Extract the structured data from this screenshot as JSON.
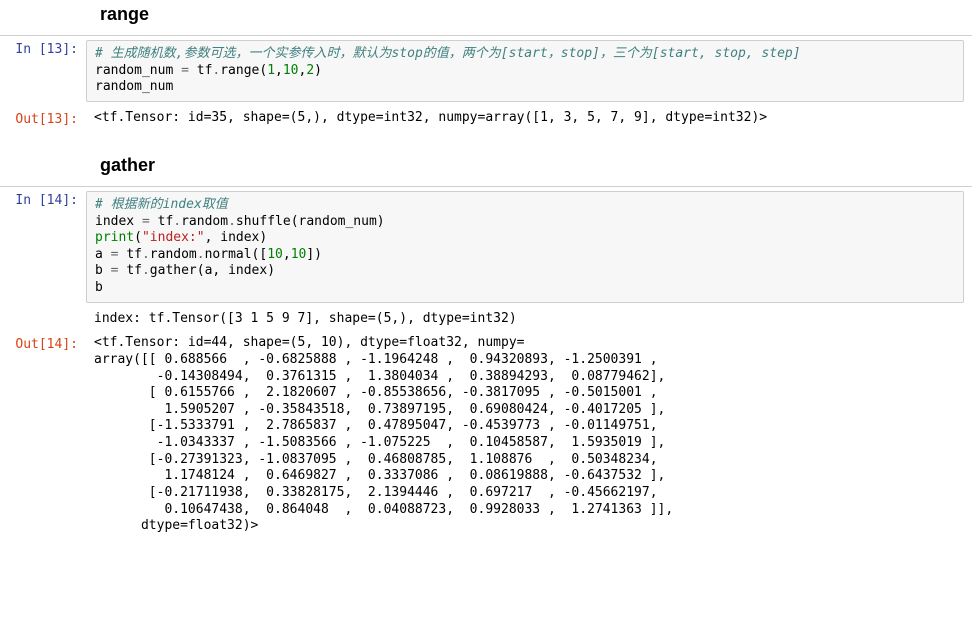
{
  "heading1": "range",
  "heading2": "gather",
  "cell13": {
    "in_label": "In [13]:",
    "out_label": "Out[13]:",
    "comment": "# 生成随机数,参数可选，一个实参传入时，默认为stop的值，两个为[start，stop]，三个为[start, stop, step]",
    "line2_a": "random_num ",
    "line2_eq": "= ",
    "line2_b": "tf",
    "line2_dot1": ".",
    "line2_c": "range(",
    "line2_n1": "1",
    "line2_com1": ",",
    "line2_n2": "10",
    "line2_com2": ",",
    "line2_n3": "2",
    "line2_d": ")",
    "line3": "random_num",
    "out": "<tf.Tensor: id=35, shape=(5,), dtype=int32, numpy=array([1, 3, 5, 7, 9], dtype=int32)>"
  },
  "cell14": {
    "in_label": "In [14]:",
    "out_label": "Out[14]:",
    "comment": "# 根据新的index取值",
    "l2a": "index ",
    "l2eq": "= ",
    "l2b": "tf",
    "l2dot": ".",
    "l2c": "random",
    "l2dot2": ".",
    "l2d": "shuffle(random_num)",
    "l3a": "print",
    "l3p": "(",
    "l3s": "\"index:\"",
    "l3c": ", index)",
    "l4a": "a ",
    "l4eq": "= ",
    "l4b": "tf",
    "l4dot": ".",
    "l4c": "random",
    "l4dot2": ".",
    "l4d": "normal([",
    "l4n1": "10",
    "l4com": ",",
    "l4n2": "10",
    "l4e": "])",
    "l5a": "b ",
    "l5eq": "= ",
    "l5b": "tf",
    "l5dot": ".",
    "l5c": "gather(a, index)",
    "l6": "b",
    "print_out": "index: tf.Tensor([3 1 5 9 7], shape=(5,), dtype=int32)",
    "out": "<tf.Tensor: id=44, shape=(5, 10), dtype=float32, numpy=\narray([[ 0.688566  , -0.6825888 , -1.1964248 ,  0.94320893, -1.2500391 ,\n        -0.14308494,  0.3761315 ,  1.3804034 ,  0.38894293,  0.08779462],\n       [ 0.6155766 ,  2.1820607 , -0.85538656, -0.3817095 , -0.5015001 ,\n         1.5905207 , -0.35843518,  0.73897195,  0.69080424, -0.4017205 ],\n       [-1.5333791 ,  2.7865837 ,  0.47895047, -0.4539773 , -0.01149751,\n        -1.0343337 , -1.5083566 , -1.075225  ,  0.10458587,  1.5935019 ],\n       [-0.27391323, -1.0837095 ,  0.46808785,  1.108876  ,  0.50348234,\n         1.1748124 ,  0.6469827 ,  0.3337086 ,  0.08619888, -0.6437532 ],\n       [-0.21711938,  0.33828175,  2.1394446 ,  0.697217  , -0.45662197,\n         0.10647438,  0.864048  ,  0.04088723,  0.9928033 ,  1.2741363 ]],\n      dtype=float32)>"
  }
}
